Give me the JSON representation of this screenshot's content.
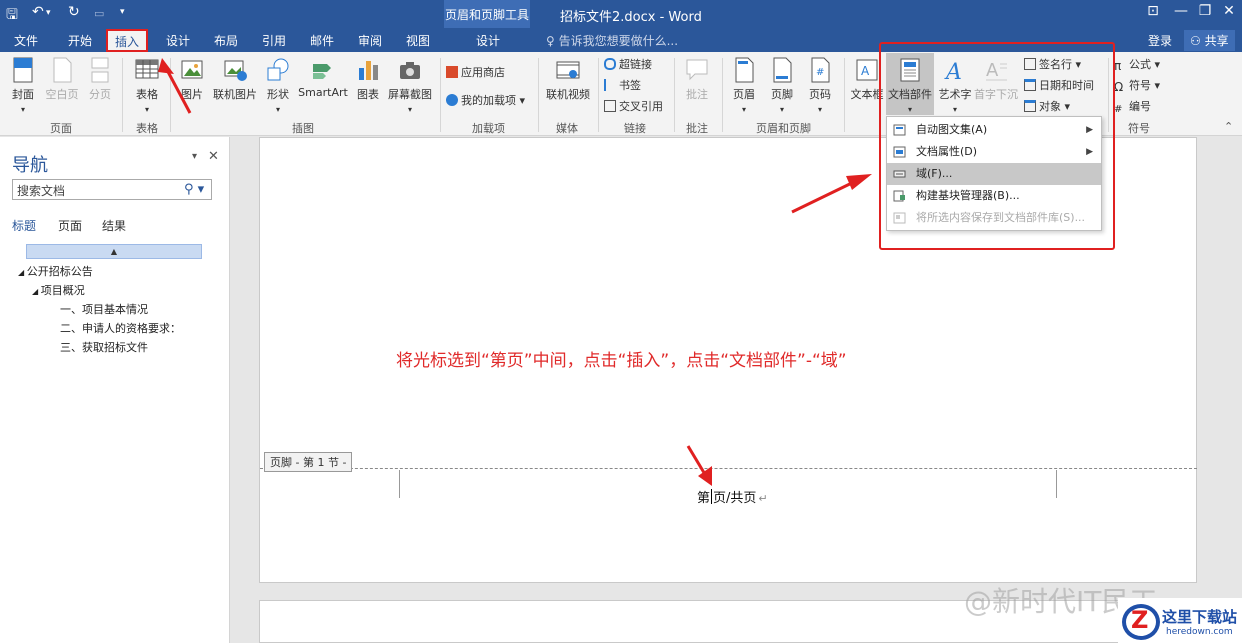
{
  "title_bar": {
    "contextual_tool": "页眉和页脚工具",
    "document_title": "招标文件2.docx - Word"
  },
  "tabs": {
    "file": "文件",
    "home": "开始",
    "insert": "插入",
    "design": "设计",
    "layout": "布局",
    "references": "引用",
    "mailings": "邮件",
    "review": "审阅",
    "view": "视图",
    "hf_design": "设计",
    "tell_me": "告诉我您想要做什么...",
    "login": "登录",
    "share": "共享"
  },
  "ribbon": {
    "cover": "封面",
    "blank_page": "空白页",
    "page_break": "分页",
    "table": "表格",
    "picture": "图片",
    "online_picture": "联机图片",
    "shapes": "形状",
    "smartart": "SmartArt",
    "chart": "图表",
    "screenshot": "屏幕截图",
    "app_store": "应用商店",
    "my_addins": "我的加载项",
    "online_video": "联机视频",
    "hyperlink": "超链接",
    "bookmark": "书签",
    "cross_ref": "交叉引用",
    "comment": "批注",
    "header": "页眉",
    "footer": "页脚",
    "page_number": "页码",
    "textbox": "文本框",
    "doc_parts": "文档部件",
    "wordart": "艺术字",
    "drop_cap": "首字下沉",
    "signature_line": "签名行",
    "date_time": "日期和时间",
    "object": "对象",
    "equation": "公式",
    "symbol": "符号",
    "numbering": "编号",
    "groups": {
      "pages": "页面",
      "tables": "表格",
      "illustrations": "插图",
      "addins": "加载项",
      "media": "媒体",
      "links": "链接",
      "comments": "批注",
      "header_footer": "页眉和页脚",
      "symbols": "符号"
    }
  },
  "nav": {
    "title": "导航",
    "search_placeholder": "搜索文档",
    "tabs": [
      "标题",
      "页面",
      "结果"
    ],
    "items": [
      "公开招标公告",
      "项目概况",
      "一、项目基本情况",
      "二、申请人的资格要求：",
      "三、获取招标文件"
    ]
  },
  "doc": {
    "instruction": "将光标选到“第页”中间，点击“插入”，点击“文档部件”-“域”",
    "footer_label": "页脚 - 第 1 节 -",
    "footer_text_a": "第",
    "footer_text_b": "页/共页",
    "para_mark": "↵"
  },
  "menu": {
    "items": [
      "自动图文集(A)",
      "文档属性(D)",
      "域(F)...",
      "构建基块管理器(B)...",
      "将所选内容保存到文档部件库(S)..."
    ]
  },
  "watermark": "@新时代IT民工",
  "logo": {
    "name": "这里下载站",
    "url": "heredown.com",
    "letter": "Z"
  }
}
